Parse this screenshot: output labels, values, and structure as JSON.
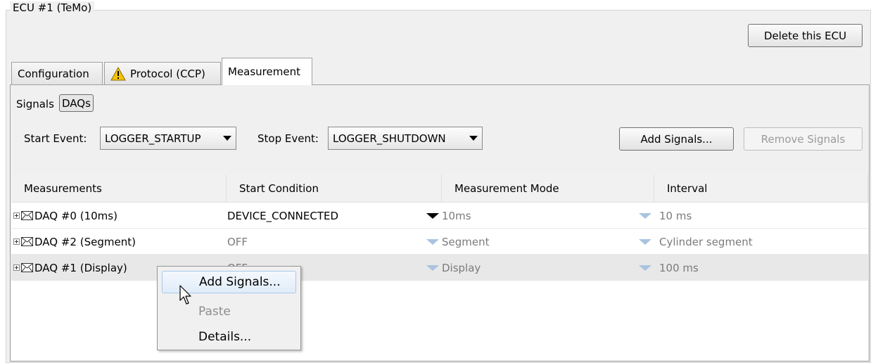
{
  "group": {
    "title": "ECU #1 (TeMo)"
  },
  "header": {
    "delete_label": "Delete this ECU"
  },
  "tabs": [
    {
      "label": "Configuration",
      "icon": "none",
      "active": false
    },
    {
      "label": "Protocol (CCP)",
      "icon": "warning-icon",
      "active": false
    },
    {
      "label": "Measurement",
      "icon": "none",
      "active": true
    }
  ],
  "subtabs": {
    "signals": "Signals",
    "daqs": "DAQs"
  },
  "events": {
    "start_label": "Start Event:",
    "start_value": "LOGGER_STARTUP",
    "stop_label": "Stop Event:",
    "stop_value": "LOGGER_SHUTDOWN"
  },
  "actions": {
    "add": "Add Signals...",
    "remove": "Remove Signals"
  },
  "table": {
    "columns": [
      "Measurements",
      "Start Condition",
      "Measurement Mode",
      "Interval"
    ],
    "rows": [
      {
        "name": "DAQ #0 (10ms)",
        "start": "DEVICE_CONNECTED",
        "mode": "10ms",
        "interval": "10 ms"
      },
      {
        "name": "DAQ #2 (Segment)",
        "start": "OFF",
        "mode": "Segment",
        "interval": "Cylinder segment"
      },
      {
        "name": "DAQ #1 (Display)",
        "start": "OFF",
        "mode": "Display",
        "interval": "100 ms"
      }
    ]
  },
  "context_menu": {
    "items": [
      {
        "label": "Add Signals...",
        "state": "hover"
      },
      {
        "label": "Paste",
        "state": "disabled"
      },
      {
        "label": "Details...",
        "state": "normal"
      }
    ]
  },
  "colors": {
    "panel_bg": "#f0f0f0",
    "menu_hover": "#e1ecf9",
    "dropdown_arrow": "#a9c3e0",
    "warning": "#f5c400"
  }
}
